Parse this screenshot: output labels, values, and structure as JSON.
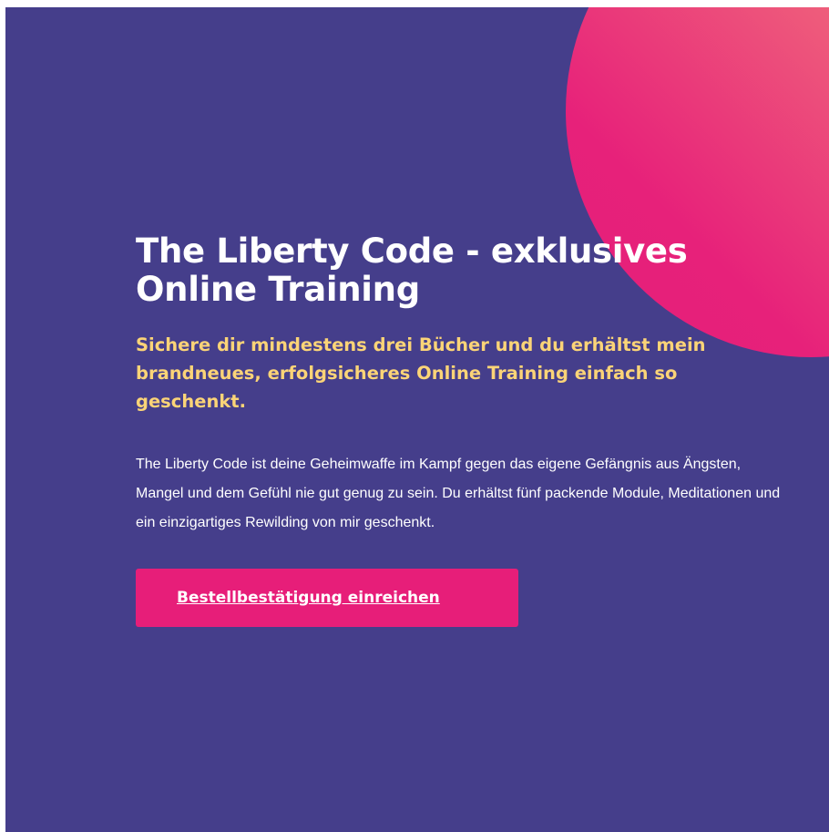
{
  "hero": {
    "title": "The Liberty Code - exklusives Online Training",
    "subtitle": "Sichere dir mindestens drei Bücher und du erhältst mein brandneues, erfolgsicheres Online Training einfach so geschenkt.",
    "body": "The Liberty Code ist deine Geheimwaffe im Kampf gegen das eigene Gefängnis aus Ängsten, Mangel und dem Gefühl nie gut genug zu sein. Du erhältst fünf packende Module, Meditationen und ein einzigartiges Rewilding von mir geschenkt.",
    "cta_label": "Bestellbestätigung einreichen"
  },
  "colors": {
    "background": "#453e8b",
    "subtitle": "#fbd477",
    "button": "#e71e79",
    "gradient_start": "#f39b74",
    "gradient_end": "#e41f79"
  }
}
